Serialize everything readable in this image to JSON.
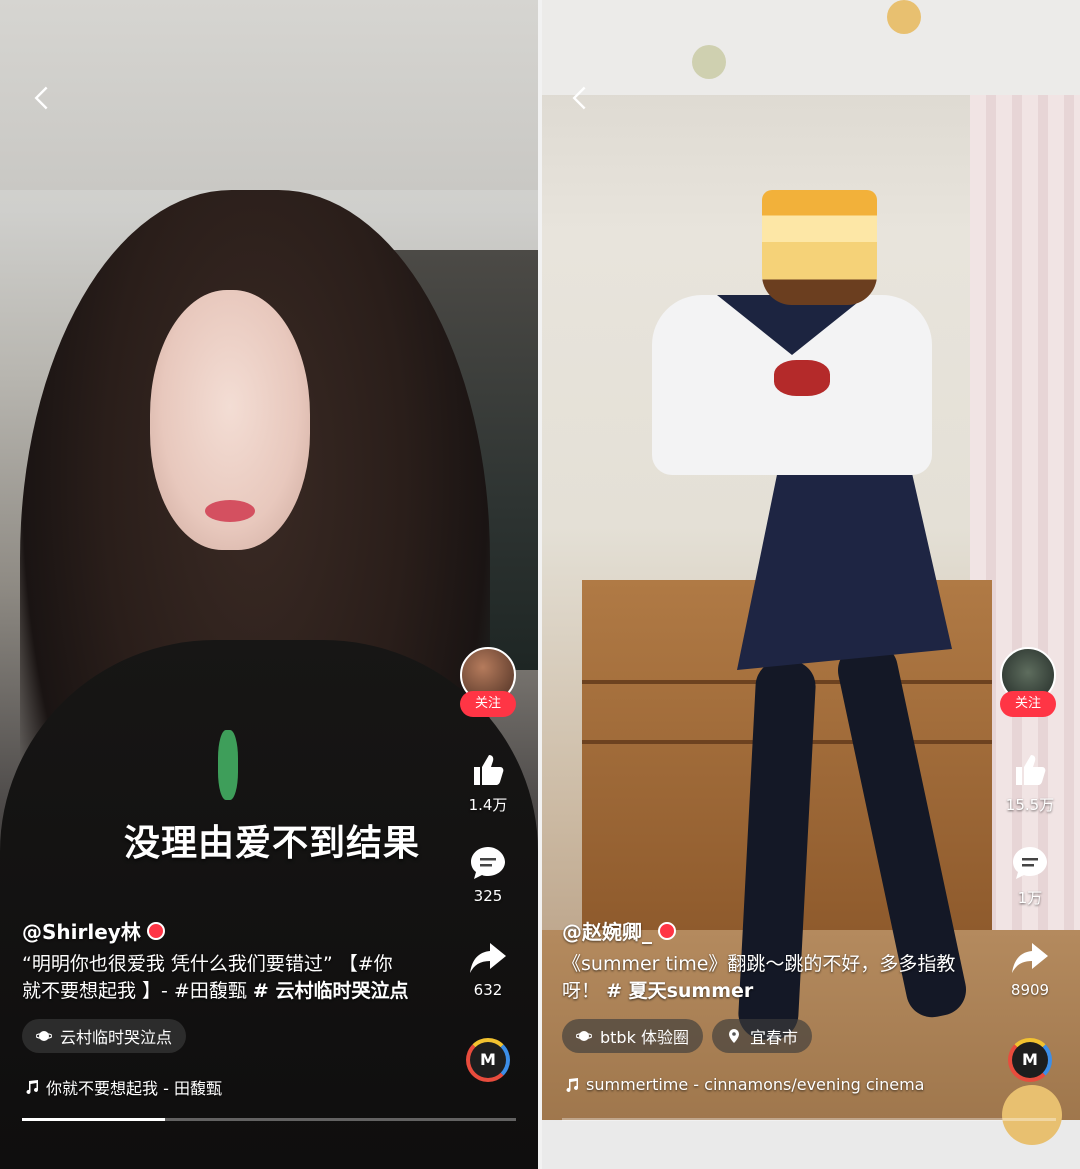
{
  "left": {
    "caption_overlay": "没理由爱不到结果",
    "follow_label": "关注",
    "likes": "1.4万",
    "comments": "325",
    "shares": "632",
    "username": "@Shirley林",
    "description_line1": "“明明你也很爱我 凭什么我们要错过” 【#你",
    "description_line2_plain": "就不要想起我 】- #田馥甄 ",
    "description_line2_bold": "# 云村临时哭泣点",
    "tag_chip": "云村临时哭泣点",
    "music": "你就不要想起我 - 田馥甄",
    "disc_letter": "M",
    "progress": 0.29
  },
  "right": {
    "follow_label": "关注",
    "likes": "15.5万",
    "comments": "1万",
    "shares": "8909",
    "username": "@赵婉卿_",
    "description_line1": "《summer time》翻跳～跳的不好，多多指教",
    "description_line2_plain": "呀！",
    "description_line2_bold": "# 夏天summer",
    "tag_chip_1": "btbk 体验圈",
    "tag_chip_2": "宜春市",
    "music": "summertime - cinnamons/evening cinema",
    "disc_letter": "M",
    "progress": 0.0
  },
  "colors": {
    "follow_red": "#ff3545",
    "overlay_text": "#ffffff"
  }
}
